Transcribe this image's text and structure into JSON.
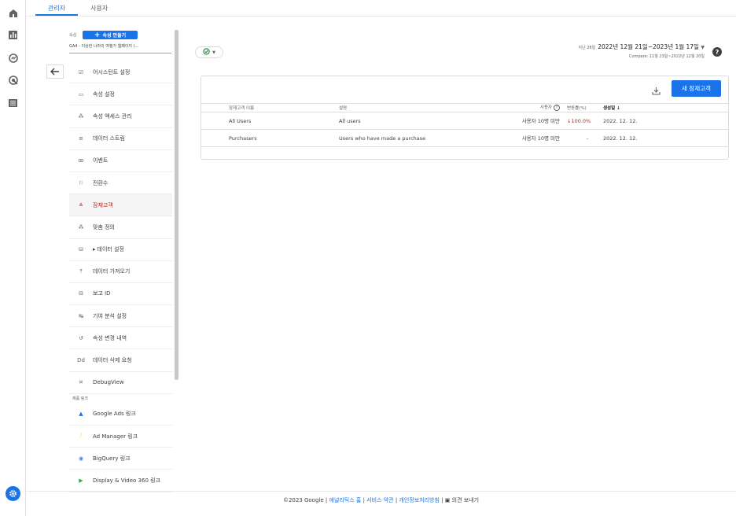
{
  "tabs": [
    {
      "label": "관리자"
    },
    {
      "label": "사용자"
    }
  ],
  "property": {
    "label": "속성",
    "create_button": "속성 만들기",
    "selected": "GA4 - 이상한 나라의 여행가 웹페이지 (..."
  },
  "menu": [
    {
      "label": "어시스턴트 설정",
      "icon": "checklist-icon"
    },
    {
      "label": "속성 설정",
      "icon": "property-settings-icon"
    },
    {
      "label": "속성 액세스 관리",
      "icon": "people-icon"
    },
    {
      "label": "데이터 스트림",
      "icon": "data-stream-icon"
    },
    {
      "label": "이벤트",
      "icon": "event-icon"
    },
    {
      "label": "전환수",
      "icon": "flag-icon"
    },
    {
      "label": "잠재고객",
      "icon": "audience-icon"
    },
    {
      "label": "맞춤 정의",
      "icon": "custom-definitions-icon"
    },
    {
      "label": "데이터 설정",
      "icon": "database-icon"
    },
    {
      "label": "데이터 가져오기",
      "icon": "upload-icon"
    },
    {
      "label": "보고 ID",
      "icon": "reporting-id-icon"
    },
    {
      "label": "기여 분석 설정",
      "icon": "attribution-icon"
    },
    {
      "label": "속성 변경 내역",
      "icon": "history-icon"
    },
    {
      "label": "데이터 삭제 요청",
      "icon": "data-deletion-icon"
    },
    {
      "label": "DebugView",
      "icon": "debug-icon"
    }
  ],
  "product_links_label": "제품 링크",
  "product_links": [
    {
      "label": "Google Ads 링크",
      "icon": "google-ads-icon"
    },
    {
      "label": "Ad Manager 링크",
      "icon": "ad-manager-icon"
    },
    {
      "label": "BigQuery 링크",
      "icon": "bigquery-icon"
    },
    {
      "label": "Display & Video 360 링크",
      "icon": "display-video-icon"
    }
  ],
  "date": {
    "prefix": "지난 28일",
    "range": "2022년 12월 21일~2023년 1월 17일",
    "compare": "Compare: 11월 23일~2022년 12월 20일"
  },
  "table": {
    "new_button": "새 잠재고객",
    "headers": {
      "name": "잠재고객 이름",
      "description": "설명",
      "users": "사용자",
      "change": "변동률(%)",
      "created": "생성일"
    },
    "rows": [
      {
        "name": "All Users",
        "description": "All users",
        "users": "사용자 10명 미만",
        "change": "100.0%",
        "created": "2022. 12. 12."
      },
      {
        "name": "Purchasers",
        "description": "Users who have made a purchase",
        "users": "사용자 10명 미만",
        "change": "-",
        "created": "2022. 12. 12."
      }
    ]
  },
  "footer": {
    "copyright": "©2023 Google | ",
    "links": [
      "애널리틱스 홈",
      "서비스 약관",
      "개인정보처리방침"
    ],
    "feedback": "의견 보내기"
  },
  "colors": {
    "accent": "#1a73e8",
    "negative": "#c5221f",
    "active_menu": "#c5221f"
  }
}
